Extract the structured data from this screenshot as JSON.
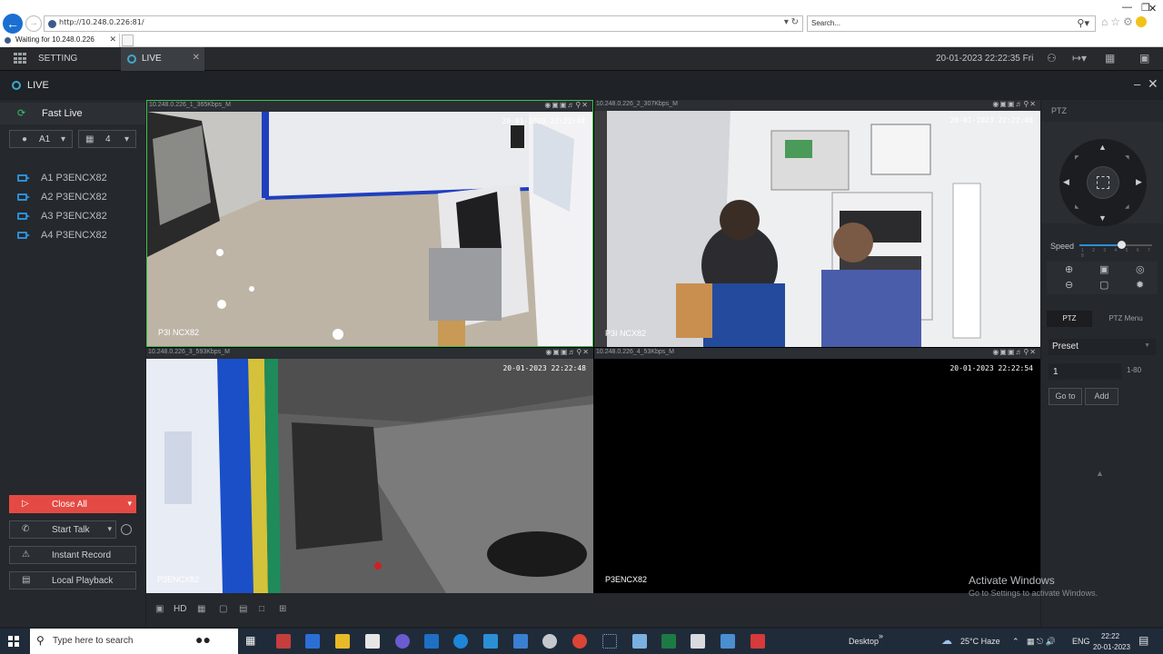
{
  "browser": {
    "url": "http://10.248.0.226:81/",
    "url_host": "10.248.0.226",
    "search_placeholder": "Search...",
    "tab_title": "Waiting for 10.248.0.226"
  },
  "header": {
    "setting_label": "SETTING",
    "live_tab_label": "LIVE",
    "datetime": "20-01-2023 22:22:35 Fri"
  },
  "page": {
    "title": "LIVE"
  },
  "left_panel": {
    "fast_live": "Fast Live",
    "stream_select": "A1",
    "layout_select": "4",
    "devices": [
      "A1 P3ENCX82",
      "A2 P3ENCX82",
      "A3 P3ENCX82",
      "A4 P3ENCX82"
    ],
    "buttons": {
      "close_all": "Close All",
      "start_talk": "Start Talk",
      "instant_record": "Instant Record",
      "local_playback": "Local Playback"
    }
  },
  "tiles": [
    {
      "info": "10.248.0.226_1_365Kbps_M",
      "timestamp": "20-01-2023 22:22:48",
      "label": "P3I NCX82"
    },
    {
      "info": "10.248.0.226_2_307Kbps_M",
      "timestamp": "20-01-2023 22:22:48",
      "label": "P3I NCX82"
    },
    {
      "info": "10.248.0.226_3_593Kbps_M",
      "timestamp": "20-01-2023 22:22:48",
      "label": "P3ENCX82"
    },
    {
      "info": "10.248.0.226_4_53Kbps_M",
      "timestamp": "20-01-2023 22:22:54",
      "label": "P3ENCX82"
    }
  ],
  "grid_toolbar": {
    "hd_label": "HD"
  },
  "ptz": {
    "title": "PTZ",
    "speed_label": "Speed",
    "speed_ticks": "1 2 3 4 5 6 7 8",
    "speed_value": 0.58,
    "tab_ptz": "PTZ",
    "tab_menu": "PTZ Menu",
    "preset_select": "Preset",
    "preset_value": "1",
    "preset_range": "1-80",
    "goto_label": "Go to",
    "add_label": "Add"
  },
  "watermark": {
    "line1": "Activate Windows",
    "line2": "Go to Settings to activate Windows."
  },
  "taskbar": {
    "search_placeholder": "Type here to search",
    "desktop_label": "Desktop",
    "weather": "25°C  Haze",
    "lang": "ENG",
    "time": "22:22",
    "date": "20-01-2023"
  },
  "colors": {
    "accent_blue": "#2b8fd6",
    "close_all_red": "#e44a43",
    "selected_tile_border": "#3cc24d"
  }
}
